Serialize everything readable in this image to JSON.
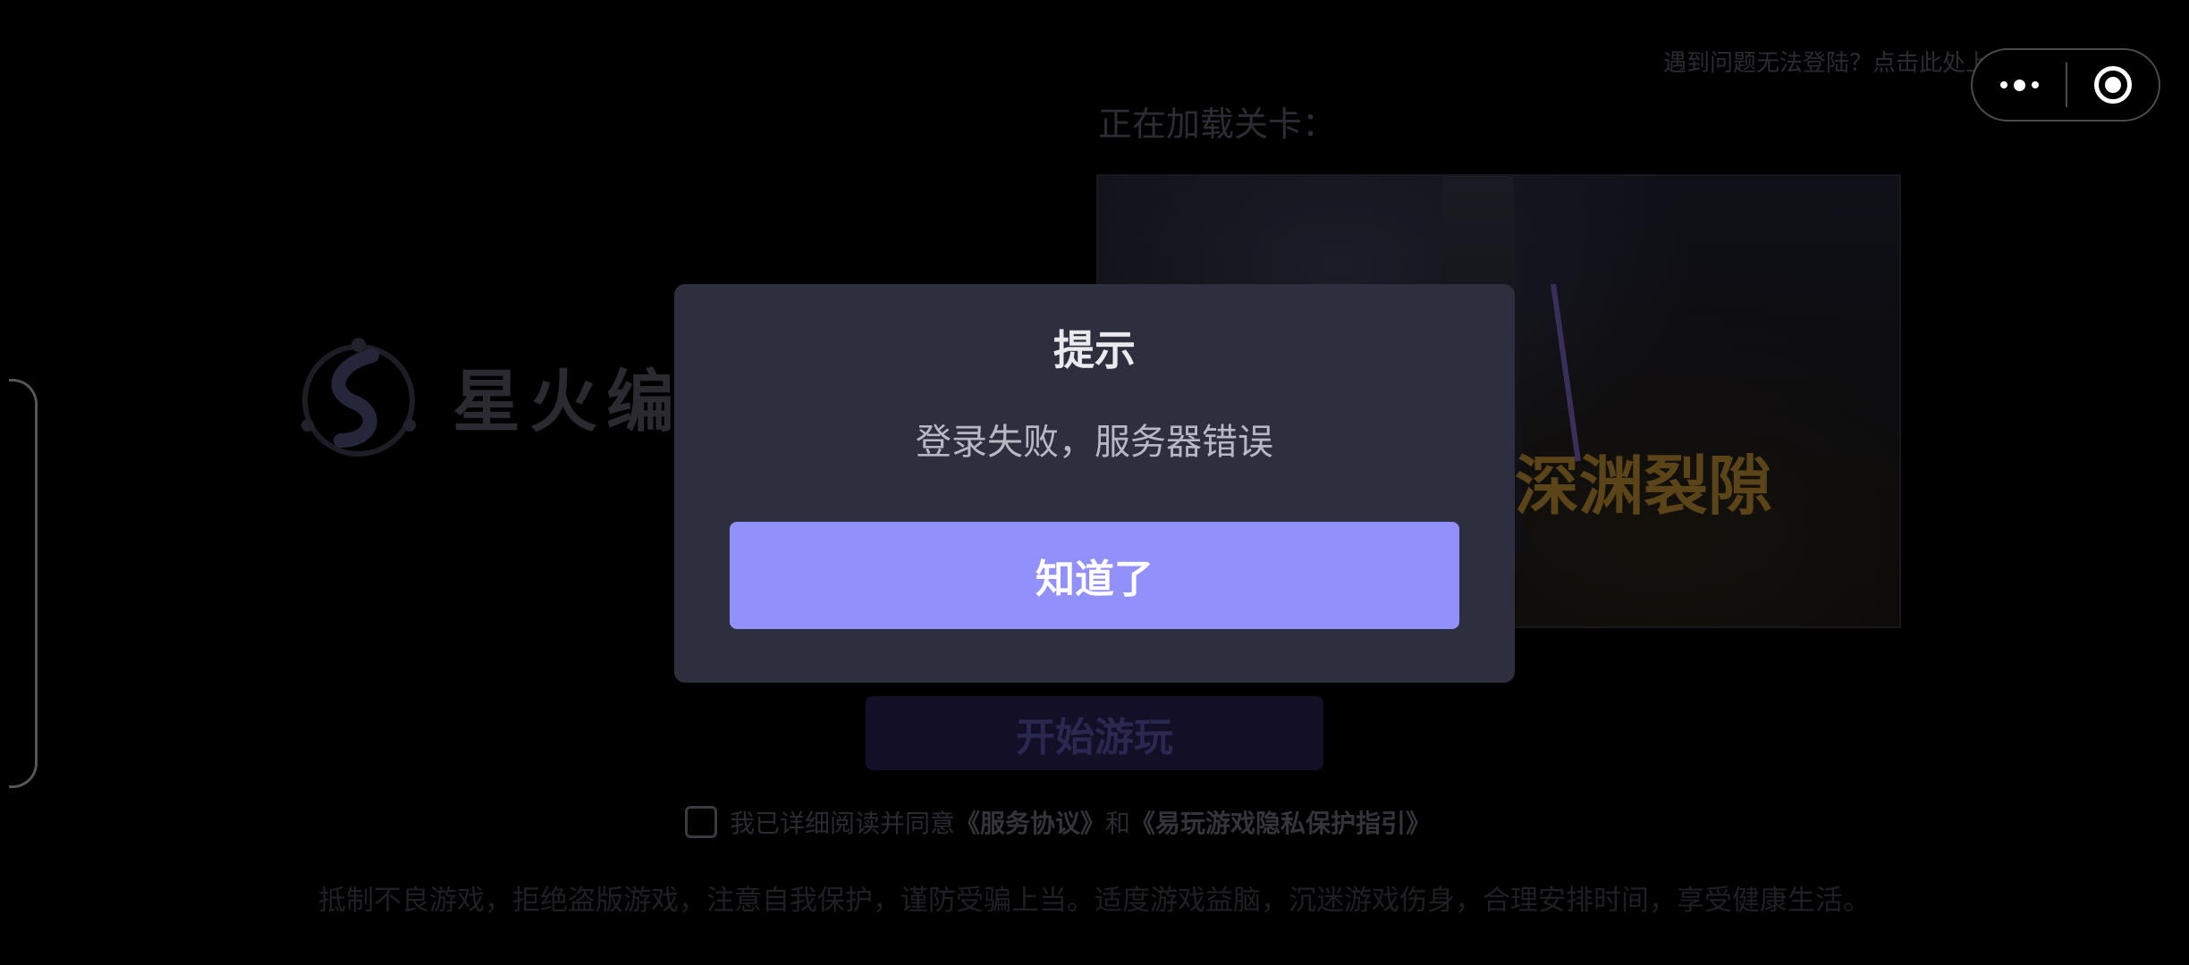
{
  "topbar": {
    "help_link": "遇到问题无法登陆？点击此处上传日志>"
  },
  "capsule": {
    "more_icon": "more-dots-icon",
    "close_icon": "target-close-icon"
  },
  "loading": {
    "label": "正在加载关卡：",
    "level_title": "深渊裂隙"
  },
  "logo": {
    "text": "星火编"
  },
  "start_button": "开始游玩",
  "agreement": {
    "prefix": "我已详细阅读并同意",
    "service_link": "《服务协议》",
    "and": "和",
    "privacy_link": "《易玩游戏隐私保护指引》"
  },
  "footer_tip": "抵制不良游戏，拒绝盗版游戏，注意自我保护，谨防受骗上当。适度游戏益脑，沉迷游戏伤身，合理安排时间，享受健康生活。",
  "dialog": {
    "title": "提示",
    "message": "登录失败，服务器错误",
    "confirm": "知道了"
  },
  "colors": {
    "dialog_bg": "#2d2f3e",
    "accent": "#9291fb",
    "background": "#000000"
  }
}
